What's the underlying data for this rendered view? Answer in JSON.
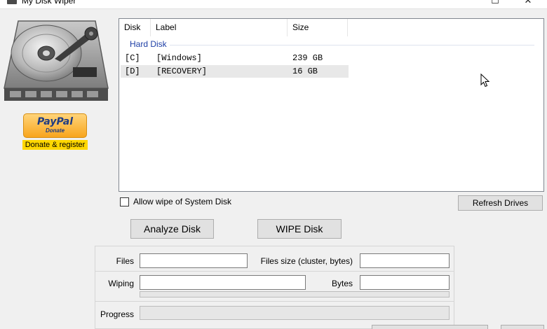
{
  "window": {
    "title": "My Disk Wiper",
    "maximize_glyph": "☐",
    "close_glyph": "✕"
  },
  "sidebar": {
    "logo_icon": "hard-disk-drive-icon",
    "paypal": {
      "brand": "PayPal",
      "sub": "Donate"
    },
    "donate_register": "Donate & register"
  },
  "disk_list": {
    "columns": {
      "disk": "Disk",
      "label": "Label",
      "size": "Size"
    },
    "group": "Hard Disk",
    "rows": [
      {
        "disk": "[C]",
        "label": "[Windows]",
        "size": "239 GB",
        "struck": true
      },
      {
        "disk": "[D]",
        "label": "[RECOVERY]",
        "size": "16 GB",
        "struck": false
      }
    ]
  },
  "options": {
    "allow_system_wipe": "Allow wipe of System Disk",
    "allow_system_wipe_checked": false
  },
  "buttons": {
    "refresh": "Refresh Drives",
    "analyze": "Analyze Disk",
    "wipe": "WIPE Disk"
  },
  "stats": {
    "files_label": "Files",
    "files_value": "",
    "files_size_label": "Files size (cluster, bytes)",
    "files_size_value": "",
    "wiping_label": "Wiping",
    "wiping_value": "",
    "bytes_label": "Bytes",
    "bytes_value": "",
    "progress_label": "Progress",
    "wiping_progress": 0,
    "overall_progress": 0
  },
  "colors": {
    "group_header": "#1e3fa6",
    "donate_highlight": "#ffd700",
    "paypal_orange": "#f8a51d",
    "paypal_blue": "#1f3c82"
  }
}
